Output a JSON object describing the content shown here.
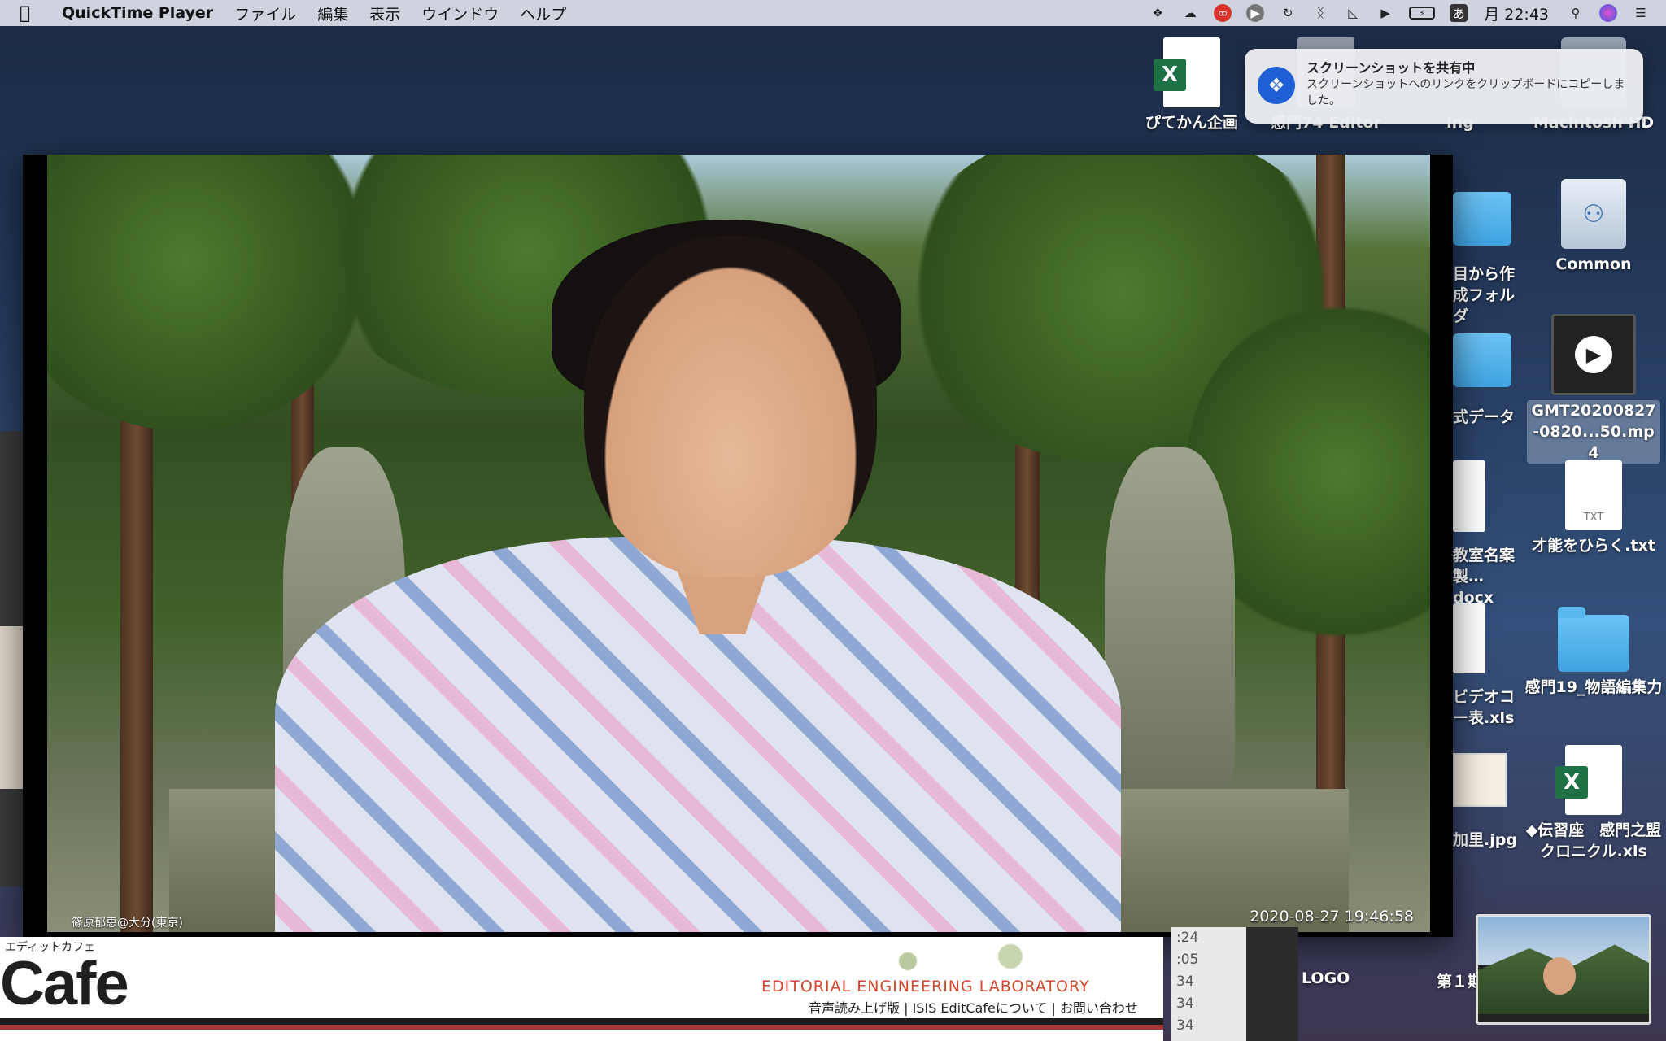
{
  "menubar": {
    "apple": "",
    "app_name": "QuickTime Player",
    "items": [
      "ファイル",
      "編集",
      "表示",
      "ウインドウ",
      "ヘルプ"
    ],
    "status_icons": [
      "dropbox-icon",
      "creative-cloud-icon",
      "ribbon-icon",
      "play-icon",
      "time-machine-icon",
      "bluetooth-icon",
      "wifi-icon",
      "volume-icon",
      "battery-icon",
      "input-method-icon"
    ],
    "input_method": "あ",
    "clock": "月 22:43"
  },
  "notification": {
    "title": "スクリーンショットを共有中",
    "body": "スクリーンショットへのリンクをクリップボードにコピーしました。"
  },
  "desktop": {
    "top_row": [
      {
        "label": "ぴてかん企画",
        "type": "xls"
      },
      {
        "label": "感門74 Editor",
        "type": "doc"
      },
      {
        "label": "ing",
        "type": "folder"
      },
      {
        "label": "Macintosh HD",
        "type": "drive"
      }
    ],
    "right_col": [
      {
        "label": "Common",
        "type": "drive"
      },
      {
        "label": "GMT20200827-0820...50.mp4",
        "type": "video"
      },
      {
        "label": "才能をひらく.txt",
        "type": "txt"
      },
      {
        "label": "感門19_物語編集力",
        "type": "folder"
      },
      {
        "label": "◆伝習座　感門之盟クロニクル.xls",
        "type": "xls"
      }
    ],
    "partial_col": [
      {
        "label": "目から作成フォルダ"
      },
      {
        "label": "式データ"
      },
      {
        "label": "教室名案製…docx"
      },
      {
        "label": "ビデオコー表.xls"
      },
      {
        "label": "加里.jpg"
      }
    ],
    "bottom_labels": [
      "LOGO",
      "第１期"
    ]
  },
  "video": {
    "participant_name": "篠原郁恵@大分(東京)",
    "timestamp": "2020-08-27  19:46:58"
  },
  "site": {
    "small_title": "エディットカフェ",
    "logo": "Cafe",
    "lab": "EDITORIAL ENGINEERING LABORATORY",
    "links": "音声読み上げ版 | ISIS EditCafeについて | お問い合わせ"
  },
  "numbers": [
    ":24",
    ":05",
    "34",
    "34",
    "34"
  ],
  "colors": {
    "menubar": "#dee2ec",
    "notification_icon": "#1f5fd6",
    "excel_green": "#1e7145",
    "folder_blue": "#4fb2ea",
    "site_accent": "#d3472c"
  }
}
